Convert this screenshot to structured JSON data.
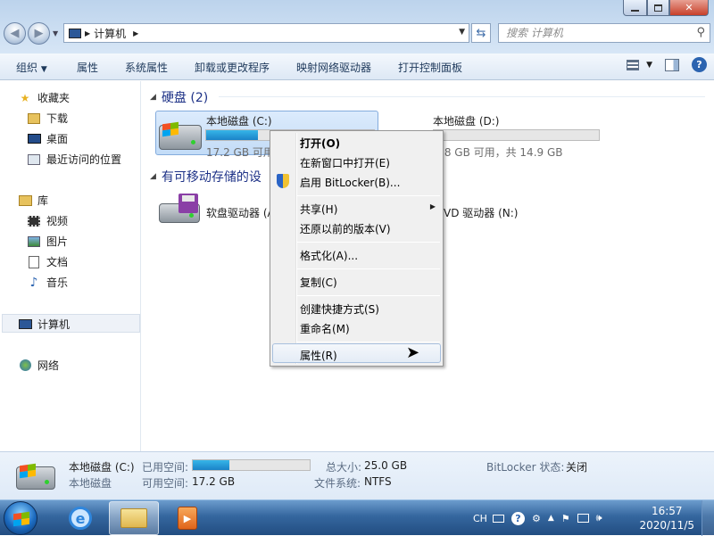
{
  "address_bar": {
    "path": "计算机",
    "search_placeholder": "搜索 计算机"
  },
  "toolbar": {
    "organize": "组织",
    "properties": "属性",
    "system_properties": "系统属性",
    "uninstall": "卸载或更改程序",
    "map_drive": "映射网络驱动器",
    "control_panel": "打开控制面板"
  },
  "sidebar": {
    "favorites": "收藏夹",
    "downloads": "下载",
    "desktop": "桌面",
    "recent": "最近访问的位置",
    "libraries": "库",
    "videos": "视频",
    "pictures": "图片",
    "documents": "文档",
    "music": "音乐",
    "computer": "计算机",
    "network": "网络"
  },
  "content": {
    "hdd_group": "硬盘 (2)",
    "removable_group": "有可移动存储的设",
    "drive_c": {
      "name": "本地磁盘 (C:)",
      "free": "17.2 GB 可用",
      "used_fraction": 0.31
    },
    "drive_d": {
      "name": "本地磁盘 (D:)",
      "free": ".8 GB 可用，共 14.9 GB",
      "used_fraction": 0.0
    },
    "floppy": "软盘驱动器 (A",
    "dvd": "VD 驱动器 (N:)"
  },
  "context_menu": {
    "open": "打开(O)",
    "open_new_window": "在新窗口中打开(E)",
    "bitlocker": "启用 BitLocker(B)...",
    "share": "共享(H)",
    "restore": "还原以前的版本(V)",
    "format": "格式化(A)...",
    "copy": "复制(C)",
    "shortcut": "创建快捷方式(S)",
    "rename": "重命名(M)",
    "properties": "属性(R)"
  },
  "details": {
    "name": "本地磁盘 (C:)",
    "type": "本地磁盘",
    "used_label": "已用空间:",
    "free_label": "可用空间:",
    "free_value": "17.2 GB",
    "total_label": "总大小:",
    "total_value": "25.0 GB",
    "fs_label": "文件系统:",
    "fs_value": "NTFS",
    "bitlocker_label": "BitLocker 状态:",
    "bitlocker_value": "关闭",
    "used_fraction": 0.31
  },
  "taskbar": {
    "lang": "CH",
    "time": "16:57",
    "date": "2020/11/5"
  },
  "colors": {
    "accent": "#1e3287",
    "progress": "#1a83c7"
  }
}
